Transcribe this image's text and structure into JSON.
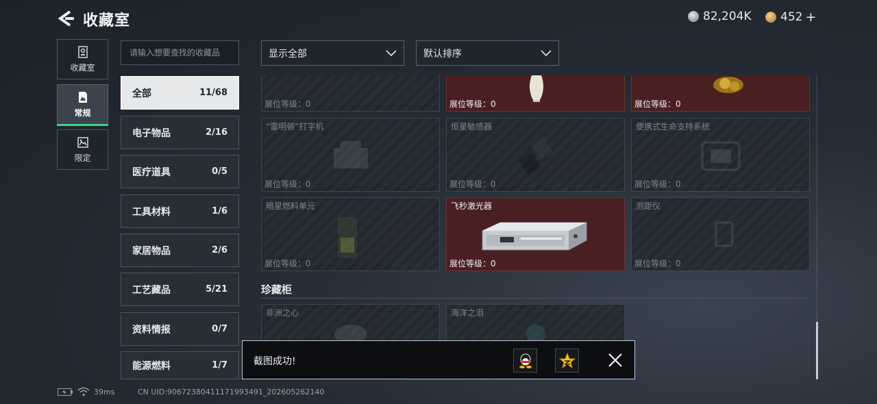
{
  "header": {
    "title": "收藏室"
  },
  "currency": {
    "silver": "82,204K",
    "gold": "452",
    "gold_add": "+"
  },
  "rail": [
    {
      "label": "收藏室",
      "icon": "collection-room-icon"
    },
    {
      "label": "常规",
      "icon": "regular-icon"
    },
    {
      "label": "限定",
      "icon": "limited-icon"
    }
  ],
  "search": {
    "placeholder": "请输入想要查找的收藏品"
  },
  "categories": [
    {
      "label": "全部",
      "count": "11/68"
    },
    {
      "label": "电子物品",
      "count": "2/16"
    },
    {
      "label": "医疗道具",
      "count": "0/5"
    },
    {
      "label": "工具材料",
      "count": "1/6"
    },
    {
      "label": "家居物品",
      "count": "2/6"
    },
    {
      "label": "工艺藏品",
      "count": "5/21"
    },
    {
      "label": "资料情报",
      "count": "0/7"
    },
    {
      "label": "能源燃料",
      "count": "1/7"
    }
  ],
  "filters": {
    "display": "显示全部",
    "sort": "默认排序"
  },
  "level_label": "展位等级：0",
  "cards": [
    {
      "name": "",
      "level": "展位等级：0",
      "owned": false
    },
    {
      "name": "",
      "level": "展位等级：0",
      "owned": true
    },
    {
      "name": "",
      "level": "展位等级：0",
      "owned": true
    },
    {
      "name": "“雷明顿”打字机",
      "level": "展位等级：0",
      "owned": false
    },
    {
      "name": "恒星敏感器",
      "level": "展位等级：0",
      "owned": false
    },
    {
      "name": "便携式生命支持系统",
      "level": "展位等级：0",
      "owned": false
    },
    {
      "name": "暗星燃料单元",
      "level": "展位等级：0",
      "owned": false
    },
    {
      "name": "飞秒激光器",
      "level": "展位等级：0",
      "owned": true
    },
    {
      "name": "测距仪",
      "level": "展位等级：0",
      "owned": false
    }
  ],
  "section": {
    "title": "珍藏柜"
  },
  "rare_cards": [
    {
      "name": "非洲之心"
    },
    {
      "name": "海洋之泪"
    }
  ],
  "toast": {
    "message": "截图成功!"
  },
  "status_bar": {
    "ping": "39ms",
    "uid": "CN UID:9067238041117199349​1_202605262140"
  }
}
